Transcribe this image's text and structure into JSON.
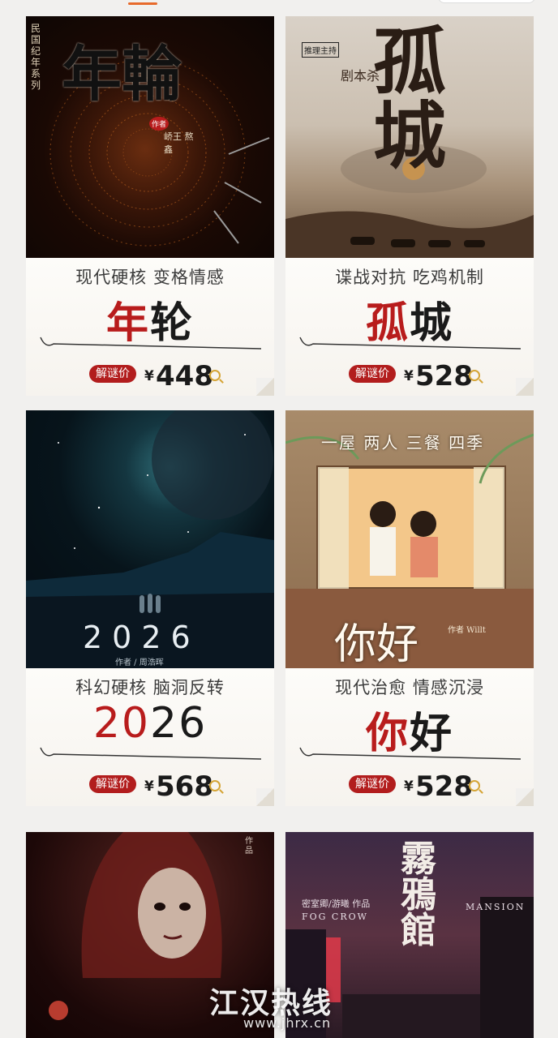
{
  "products": [
    {
      "id": "nianlun",
      "poster": {
        "title_art": "年輪",
        "series_text": "民国纪年系列",
        "author_text": "作者",
        "author_names": "峤王 熬鑫"
      },
      "tagline": "现代硬核 变格情感",
      "title_first": "年",
      "title_rest": "轮",
      "price_label": "解谜价",
      "currency": "¥",
      "price": "448"
    },
    {
      "id": "gucheng",
      "poster": {
        "title_art": "孤城",
        "subtitle": "剧本杀",
        "badge": "推理主持"
      },
      "tagline": "谍战对抗 吃鸡机制",
      "title_first": "孤",
      "title_rest": "城",
      "price_label": "解谜价",
      "currency": "¥",
      "price": "528"
    },
    {
      "id": "2026",
      "poster": {
        "title_art": "2026",
        "author_text": "作者 / 周浩晖"
      },
      "tagline": "科幻硬核 脑洞反转",
      "title_first": "20",
      "title_rest": "26",
      "price_label": "解谜价",
      "currency": "¥",
      "price": "568"
    },
    {
      "id": "nihao",
      "poster": {
        "top_text": "一屋 两人 三餐 四季",
        "title_art": "你好",
        "credits": "作者 Willt"
      },
      "tagline": "现代治愈 情感沉浸",
      "title_first": "你",
      "title_rest": "好",
      "price_label": "解谜价",
      "currency": "¥",
      "price": "528"
    },
    {
      "id": "red-poster",
      "poster": {
        "side_text": "作品"
      }
    },
    {
      "id": "wuyaguan",
      "poster": {
        "title_art": "霧鴉館",
        "credit_line": "密室卿/游曦 作品",
        "en_left": "FOG CROW",
        "en_right": "MANSION"
      }
    }
  ],
  "watermark": {
    "text": "江汉热线",
    "url": "www.jhrx.cn"
  },
  "colors": {
    "accent": "#e76a2b",
    "price_tag": "#b21d1d",
    "title_red": "#b81c1c"
  }
}
